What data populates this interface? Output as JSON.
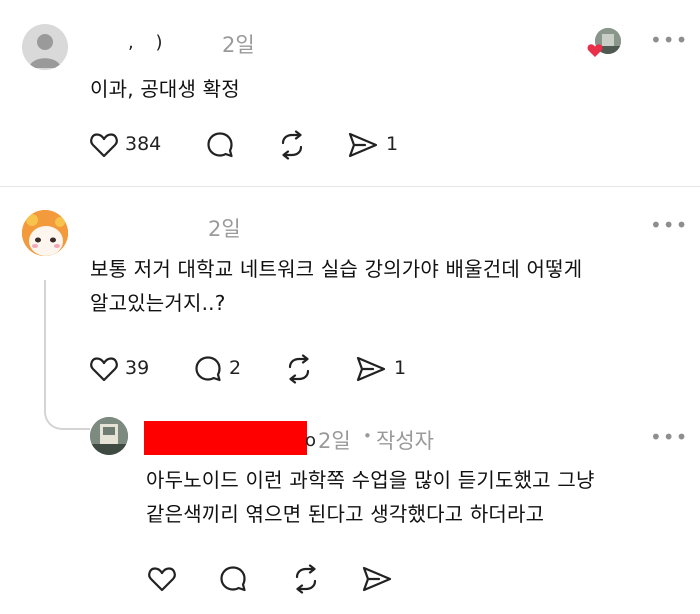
{
  "posts": [
    {
      "author_fragment": ", ) ",
      "time": "2일",
      "body_lines": [
        "이과, 공대생 확정"
      ],
      "likes": "384",
      "replies": "",
      "reposts": "",
      "shares": "1",
      "reaction": "heart-reaction"
    },
    {
      "time": "2일",
      "body_lines": [
        "보통 저거 대학교 네트워크 실습 강의가야 배울건데 어떻게",
        "알고있는거지..?"
      ],
      "likes": "39",
      "replies": "2",
      "reposts": "",
      "shares": "1"
    },
    {
      "author_suffix": "o",
      "time": "2일",
      "separator": "•",
      "author_tag": "작성자",
      "body_lines": [
        "아두노이드 이런 과학쪽 수업을 많이 듣기도했고 그냥",
        "같은색끼리  엮으면 된다고 생각했다고 하더라고"
      ]
    }
  ],
  "colors": {
    "redaction": "#ff0000",
    "reaction_heart": "#e8304a",
    "time_gray": "#9a9a9a"
  }
}
